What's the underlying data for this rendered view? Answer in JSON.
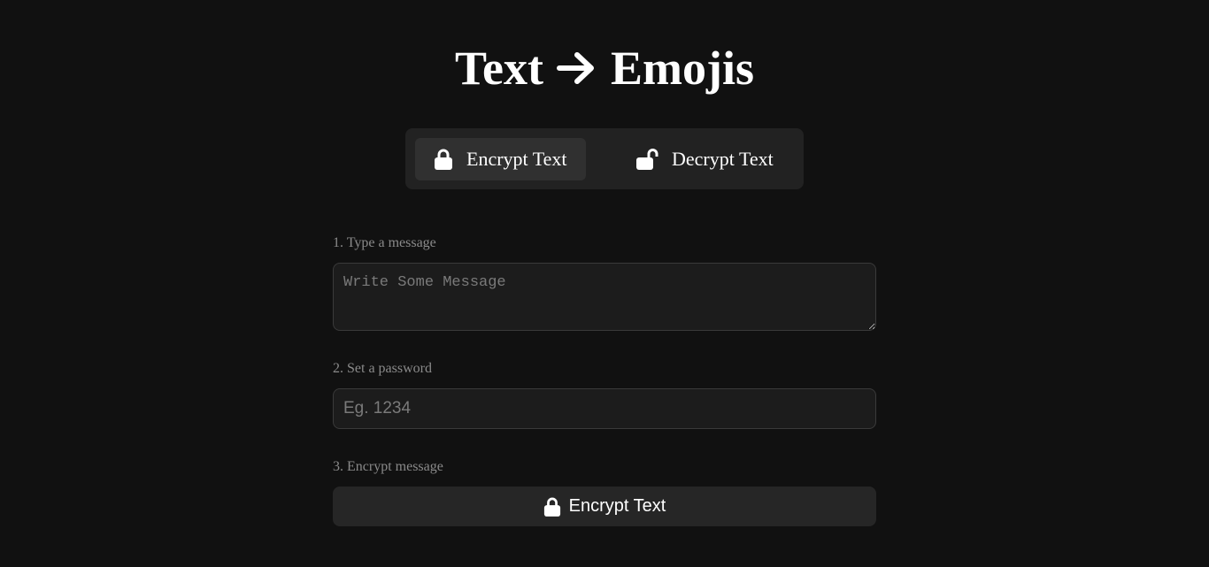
{
  "header": {
    "title_left": "Text",
    "title_right": "Emojis",
    "arrow_icon": "arrow-right-icon"
  },
  "tabs": [
    {
      "label": "Encrypt Text",
      "icon": "lock-icon",
      "active": true
    },
    {
      "label": "Decrypt Text",
      "icon": "unlock-icon",
      "active": false
    }
  ],
  "form": {
    "step1_label": "1. Type a message",
    "message_placeholder": "Write Some Message",
    "message_value": "",
    "step2_label": "2. Set a password",
    "password_placeholder": "Eg. 1234",
    "password_value": "",
    "step3_label": "3. Encrypt message",
    "submit_label": "Encrypt Text",
    "submit_icon": "lock-icon"
  },
  "colors": {
    "background": "#111111",
    "panel": "#222222",
    "active_tab": "#303030",
    "input_bg": "#1c1c1c",
    "label": "#8a8a8a",
    "text": "#ffffff"
  }
}
